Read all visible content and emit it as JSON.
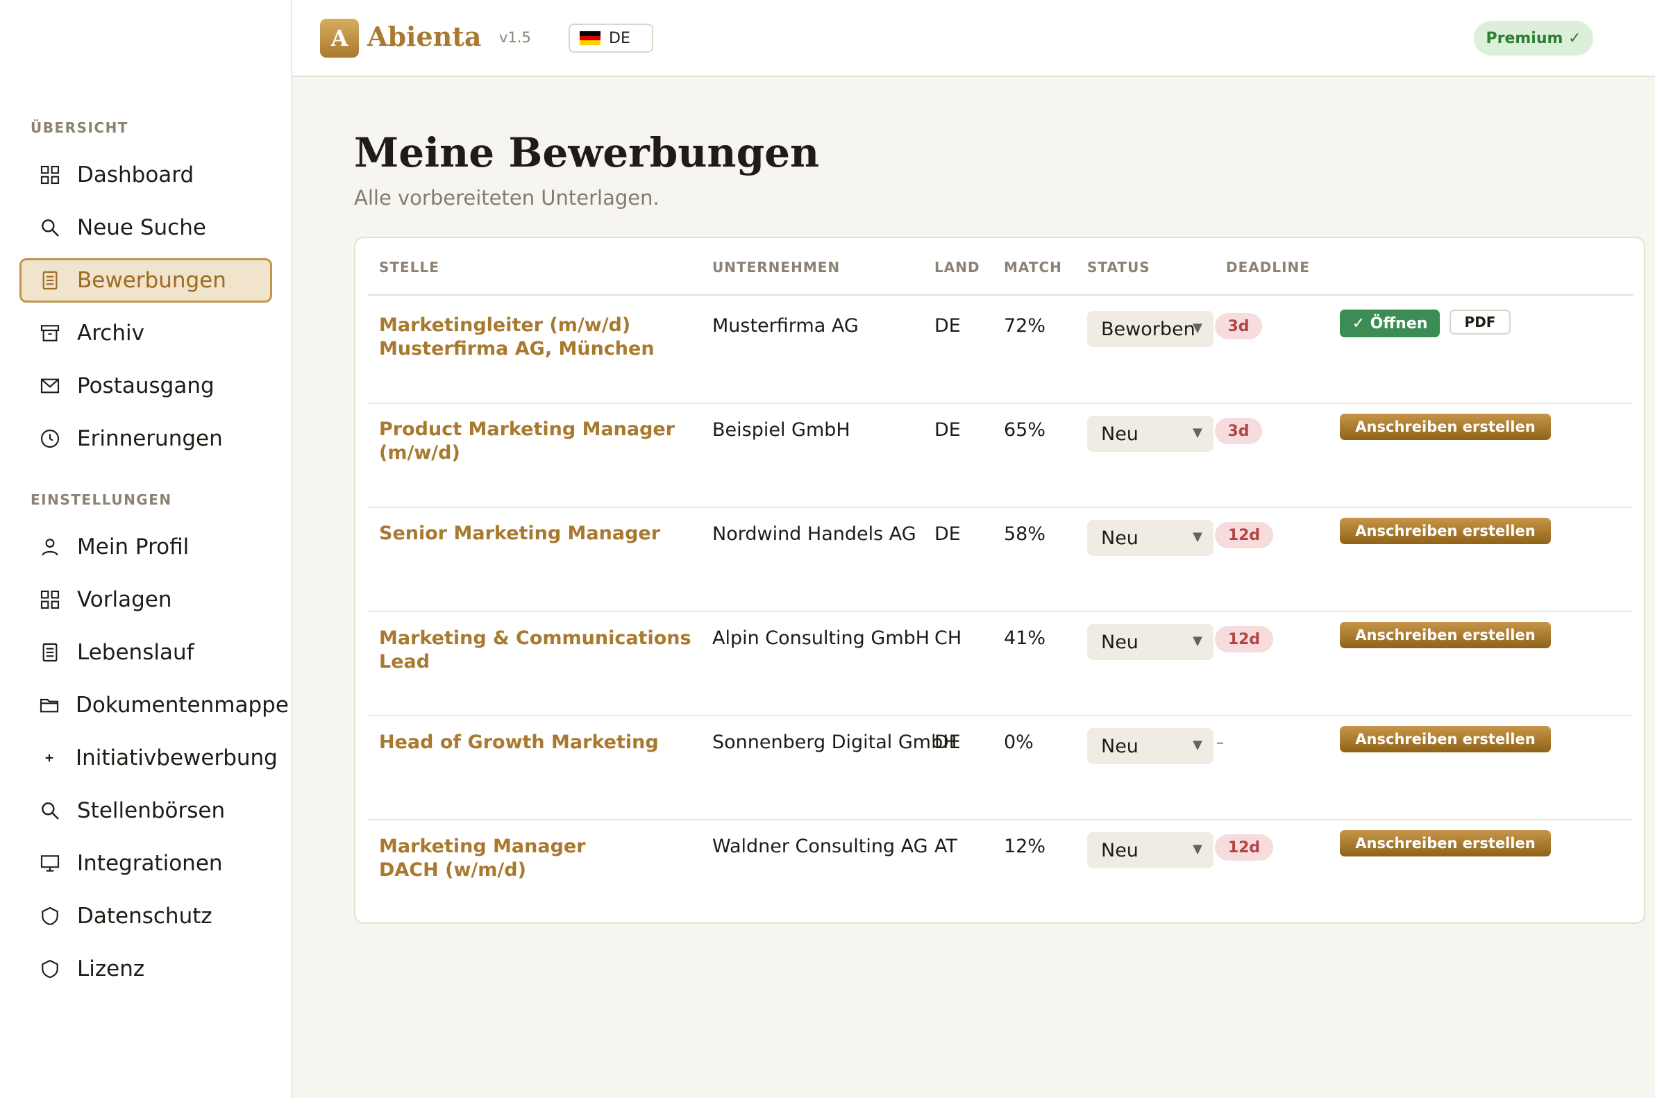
{
  "app": {
    "logo_letter": "A",
    "name": "Abienta",
    "version": "v1.5",
    "language": "DE",
    "premium_label": "Premium ✓"
  },
  "sidebar": {
    "section_overview": "ÜBERSICHT",
    "section_settings": "EINSTELLUNGEN",
    "overview_items": [
      {
        "label": "Dashboard",
        "icon": "grid-icon"
      },
      {
        "label": "Neue Suche",
        "icon": "search-icon"
      },
      {
        "label": "Bewerbungen",
        "icon": "document-icon",
        "active": true
      },
      {
        "label": "Archiv",
        "icon": "archive-icon"
      },
      {
        "label": "Postausgang",
        "icon": "mail-icon"
      },
      {
        "label": "Erinnerungen",
        "icon": "clock-icon"
      }
    ],
    "settings_items": [
      {
        "label": "Mein Profil",
        "icon": "user-icon"
      },
      {
        "label": "Vorlagen",
        "icon": "grid-icon"
      },
      {
        "label": "Lebenslauf",
        "icon": "document-icon"
      },
      {
        "label": "Dokumentenmappe",
        "icon": "folder-icon"
      },
      {
        "label": "Initiativbewerbung",
        "icon": "plus-icon"
      },
      {
        "label": "Stellenbörsen",
        "icon": "search-icon"
      },
      {
        "label": "Integrationen",
        "icon": "monitor-icon"
      },
      {
        "label": "Datenschutz",
        "icon": "shield-icon"
      },
      {
        "label": "Lizenz",
        "icon": "shield-icon"
      }
    ]
  },
  "main": {
    "title": "Meine Bewerbungen",
    "subtitle": "Alle vorbereiteten Unterlagen.",
    "columns": [
      "STELLE",
      "UNTERNEHMEN",
      "LAND",
      "MATCH",
      "STATUS",
      "DEADLINE"
    ],
    "rows": [
      {
        "title": "Marketingleiter (m/w/d)\nMusterfirma AG, München",
        "company": "Musterfirma AG",
        "country": "DE",
        "match": "72%",
        "status": "Beworben",
        "deadline": "3d",
        "action_open": "✓ Öffnen",
        "action_pdf": "PDF"
      },
      {
        "title": "Product Marketing Manager\n(m/w/d)",
        "company": "Beispiel GmbH",
        "country": "DE",
        "match": "65%",
        "status": "Neu",
        "deadline": "3d",
        "action": "Anschreiben erstellen"
      },
      {
        "title": "Senior Marketing Manager",
        "company": "Nordwind Handels AG",
        "country": "DE",
        "match": "58%",
        "status": "Neu",
        "deadline": "12d",
        "action": "Anschreiben erstellen"
      },
      {
        "title": "Marketing & Communications\nLead",
        "company": "Alpin Consulting GmbH",
        "country": "CH",
        "match": "41%",
        "status": "Neu",
        "deadline": "12d",
        "action": "Anschreiben erstellen"
      },
      {
        "title": "Head of Growth Marketing",
        "company": "Sonnenberg Digital GmbH",
        "country": "DE",
        "match": "0%",
        "status": "Neu",
        "deadline": "–",
        "action": "Anschreiben erstellen"
      },
      {
        "title": "Marketing Manager\nDACH (w/m/d)",
        "company": "Waldner Consulting AG",
        "country": "AT",
        "match": "12%",
        "status": "Neu",
        "deadline": "12d",
        "action": "Anschreiben erstellen"
      }
    ]
  },
  "colors": {
    "accent": "#a8792e",
    "active_bg": "#f1e4cc",
    "open_button": "#3b8c55",
    "deadline_bg": "#f6dcdc",
    "deadline_text": "#b24545",
    "premium_bg": "#dcefdb"
  }
}
